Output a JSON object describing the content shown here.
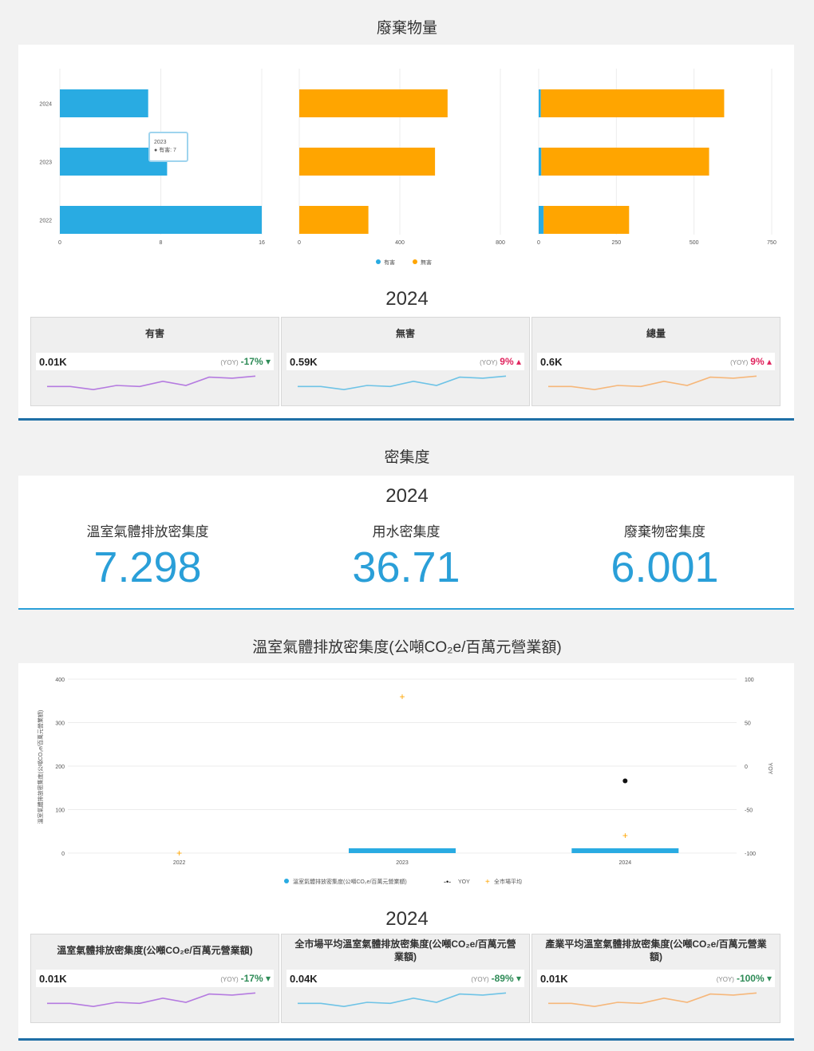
{
  "waste": {
    "title": "廢棄物量",
    "y_categories": [
      "2024",
      "2023",
      "2022"
    ],
    "legend": [
      "有害",
      "無害"
    ],
    "tooltip": {
      "year": "2023",
      "line": "● 有害: 7"
    },
    "year": "2024",
    "cards": [
      {
        "title": "有害",
        "value": "0.01K",
        "yoy_label": "(YOY)",
        "yoy": "-17% ▾",
        "yoy_color": "#2e8b57",
        "spark_color": "#b57be0"
      },
      {
        "title": "無害",
        "value": "0.59K",
        "yoy_label": "(YOY)",
        "yoy": "9% ▴",
        "yoy_color": "#e0245e",
        "spark_color": "#6ec3e6"
      },
      {
        "title": "總量",
        "value": "0.6K",
        "yoy_label": "(YOY)",
        "yoy": "9% ▴",
        "yoy_color": "#e0245e",
        "spark_color": "#f6b77a"
      }
    ]
  },
  "intensity": {
    "title": "密集度",
    "year": "2024",
    "kpis": [
      {
        "label": "溫室氣體排放密集度",
        "value": "7.298"
      },
      {
        "label": "用水密集度",
        "value": "36.71"
      },
      {
        "label": "廢棄物密集度",
        "value": "6.001"
      }
    ]
  },
  "ghg": {
    "title": "溫室氣體排放密集度(公噸CO₂e/百萬元營業額)",
    "y_left_label": "溫室氣體排放密集度(公噸CO₂e/百萬元營業額)",
    "y_right_label": "YOY",
    "legend": [
      "溫室氣體排放密集度(公噸CO₂e/百萬元營業額)",
      "YOY",
      "全市場平均"
    ],
    "year": "2024",
    "cards": [
      {
        "title": "溫室氣體排放密集度(公噸CO₂e/百萬元營業額)",
        "value": "0.01K",
        "yoy_label": "(YOY)",
        "yoy": "-17% ▾",
        "yoy_color": "#2e8b57",
        "spark_color": "#b57be0"
      },
      {
        "title": "全市場平均溫室氣體排放密集度(公噸CO₂e/百萬元營業額)",
        "value": "0.04K",
        "yoy_label": "(YOY)",
        "yoy": "-89% ▾",
        "yoy_color": "#2e8b57",
        "spark_color": "#6ec3e6"
      },
      {
        "title": "產業平均溫室氣體排放密集度(公噸CO₂e/百萬元營業額)",
        "value": "0.01K",
        "yoy_label": "(YOY)",
        "yoy": "-100% ▾",
        "yoy_color": "#2e8b57",
        "spark_color": "#f6b77a"
      }
    ]
  },
  "chart_data": [
    {
      "type": "bar",
      "orientation": "horizontal",
      "categories": [
        "2024",
        "2023",
        "2022"
      ],
      "series": [
        {
          "name": "有害",
          "values": [
            7,
            8.5,
            16
          ]
        }
      ],
      "xlim": [
        0,
        16
      ],
      "ticks": [
        "0",
        "8",
        "16"
      ],
      "color": "#29abe2"
    },
    {
      "type": "bar",
      "orientation": "horizontal",
      "categories": [
        "2024",
        "2023",
        "2022"
      ],
      "series": [
        {
          "name": "無害",
          "values": [
            590,
            540,
            275
          ]
        }
      ],
      "xlim": [
        0,
        800
      ],
      "ticks": [
        "0",
        "400",
        "800"
      ],
      "color": "#ffa500"
    },
    {
      "type": "bar",
      "orientation": "horizontal",
      "stacked": true,
      "categories": [
        "2024",
        "2023",
        "2022"
      ],
      "series": [
        {
          "name": "有害",
          "values": [
            7,
            8.5,
            16
          ]
        },
        {
          "name": "無害",
          "values": [
            590,
            540,
            275
          ]
        }
      ],
      "xlim": [
        0,
        750
      ],
      "ticks": [
        "0",
        "250",
        "500",
        "750"
      ]
    },
    {
      "type": "bar",
      "categories": [
        "2022",
        "2023",
        "2024"
      ],
      "series": [
        {
          "name": "溫室氣體排放密集度(公噸CO₂e/百萬元營業額)",
          "values": [
            0,
            8.8,
            7.3
          ]
        },
        {
          "name": "YOY",
          "values": [
            null,
            null,
            -17
          ]
        },
        {
          "name": "全市場平均",
          "values": [
            0,
            360,
            40
          ]
        }
      ],
      "ylim_left": [
        0,
        400
      ],
      "ylim_right": [
        -100,
        100
      ],
      "left_ticks": [
        "0",
        "100",
        "200",
        "300",
        "400"
      ],
      "right_ticks": [
        "-100",
        "-50",
        "0",
        "50",
        "100"
      ]
    }
  ]
}
